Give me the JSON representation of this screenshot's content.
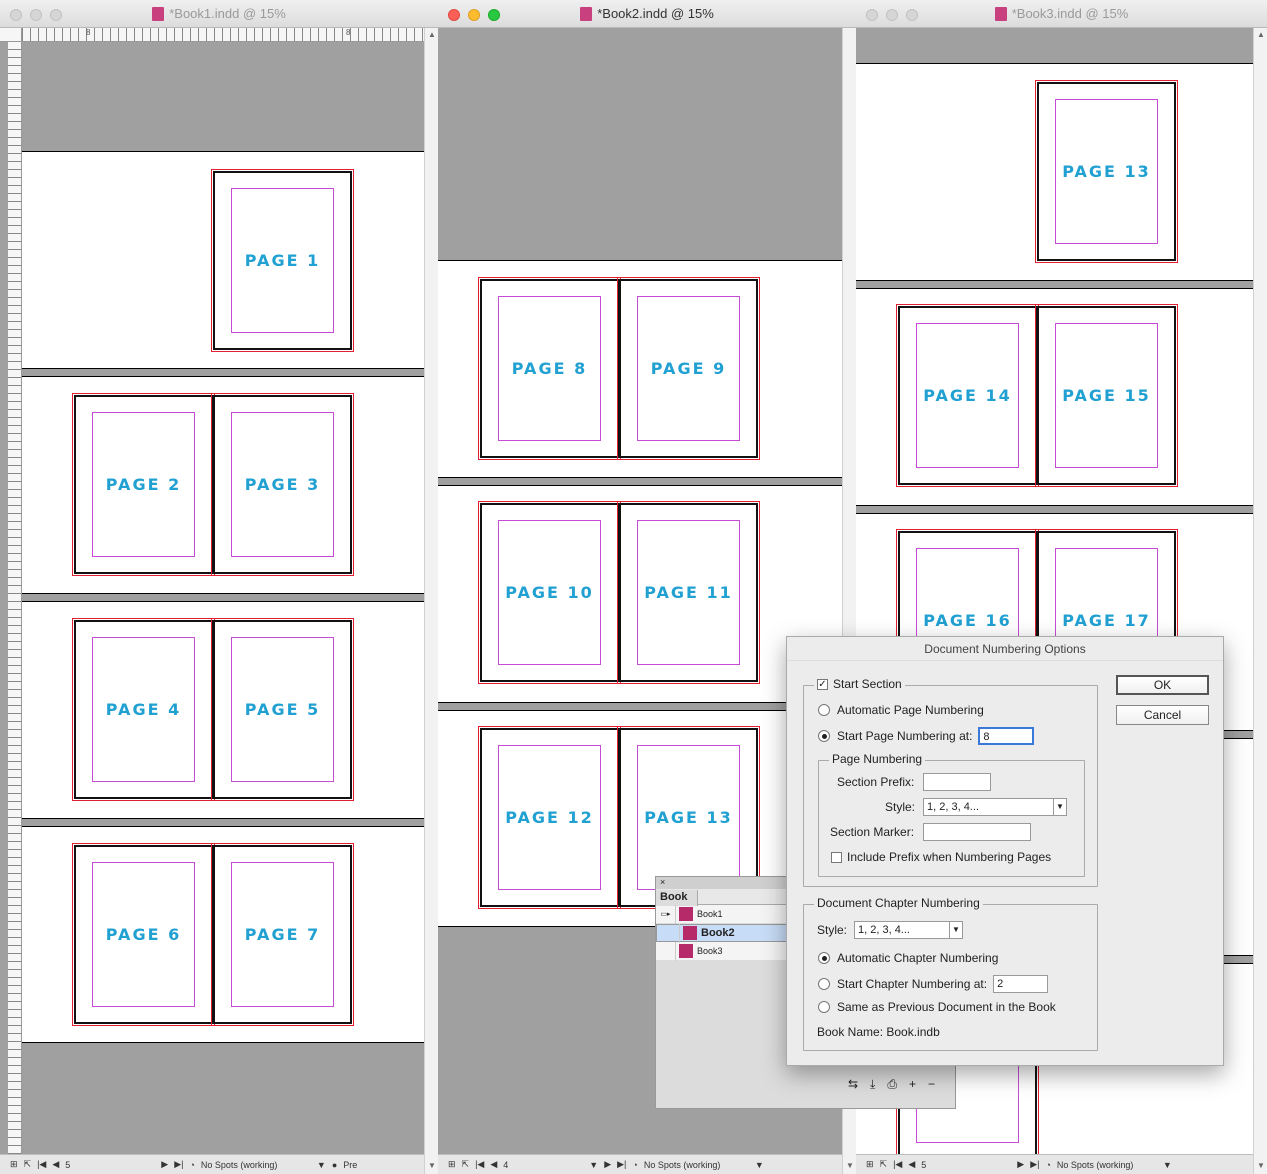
{
  "windows": [
    {
      "title": "*Book1.indd @ 15%",
      "status_page": "5",
      "status_preflight": "No Spots (working)",
      "status_extra": "Pre"
    },
    {
      "title": "*Book2.indd @ 15%",
      "status_page": "4",
      "status_preflight": "No Spots (working)"
    },
    {
      "title": "*Book3.indd @ 15%",
      "status_page": "5",
      "status_preflight": "No Spots (working)"
    }
  ],
  "rulers": {
    "h1": "8",
    "h2": "8",
    "v0": "0",
    "v8": "8"
  },
  "pages": {
    "p1": "PAGE 1",
    "p2": "PAGE 2",
    "p3": "PAGE 3",
    "p4": "PAGE 4",
    "p5": "PAGE 5",
    "p6": "PAGE 6",
    "p7": "PAGE 7",
    "p8": "PAGE 8",
    "p9": "PAGE 9",
    "p10": "PAGE 10",
    "p11": "PAGE 11",
    "p12": "PAGE 12",
    "p13a": "PAGE 13",
    "p13b": "PAGE 13",
    "p14": "PAGE 14",
    "p15": "PAGE 15",
    "p16": "PAGE 16",
    "p17": "PAGE 17"
  },
  "book_panel": {
    "close": "×",
    "tab": "Book",
    "items": [
      "Book1",
      "Book2",
      "Book3"
    ],
    "selected": "Book2"
  },
  "dialog": {
    "title": "Document Numbering Options",
    "start_section": "Start Section",
    "auto_page": "Automatic Page Numbering",
    "start_page": "Start Page Numbering at:",
    "start_page_value": "8",
    "page_numbering": "Page Numbering",
    "section_prefix": "Section Prefix:",
    "section_prefix_value": "",
    "style_label": "Style:",
    "style_value": "1, 2, 3, 4...",
    "section_marker": "Section Marker:",
    "section_marker_value": "",
    "include_prefix": "Include Prefix when Numbering Pages",
    "chapter_group": "Document Chapter Numbering",
    "chapter_style_label": "Style:",
    "chapter_style_value": "1, 2, 3, 4...",
    "auto_chapter": "Automatic Chapter Numbering",
    "start_chapter": "Start Chapter Numbering at:",
    "start_chapter_value": "2",
    "same_as_prev": "Same as Previous Document in the Book",
    "book_name": "Book Name: Book.indb",
    "ok": "OK",
    "cancel": "Cancel"
  }
}
